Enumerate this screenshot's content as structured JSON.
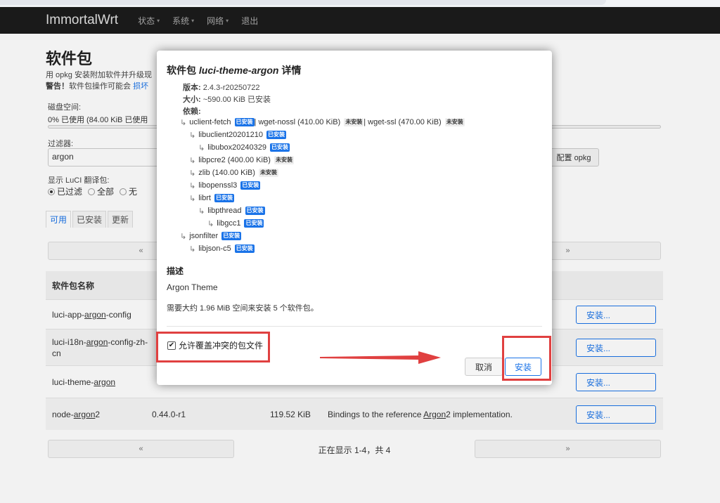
{
  "navbar": {
    "brand": "ImmortalWrt",
    "menu": [
      {
        "label": "状态",
        "has_caret": true
      },
      {
        "label": "系统",
        "has_caret": true
      },
      {
        "label": "网络",
        "has_caret": true
      },
      {
        "label": "退出",
        "has_caret": false
      }
    ]
  },
  "page": {
    "title": "软件包",
    "description": "用 opkg 安装附加软件并升级现",
    "warning_prefix": "警告！",
    "warning_text": "软件包操作可能会",
    "warning_link": "损坏",
    "disk_label": "磁盘空间:",
    "disk_value": "0% 已使用 (84.00 KiB 已使用",
    "filter_label": "过滤器:",
    "filter_value": "argon",
    "config_button": "配置 opkg",
    "luci_label": "显示 LuCI 翻译包:",
    "radio_options": [
      {
        "label": "已过滤",
        "checked": true
      },
      {
        "label": "全部",
        "checked": false
      },
      {
        "label": "无",
        "checked": false
      }
    ],
    "tabs": [
      {
        "label": "可用",
        "active": true
      },
      {
        "label": "已安装",
        "active": false
      },
      {
        "label": "更新",
        "active": false
      }
    ],
    "pager": {
      "prev": "«",
      "next": "»",
      "info": "正在显示 1-4，共 4"
    },
    "table": {
      "header": "软件包名称",
      "rows": [
        {
          "name_pre": "luci-app-",
          "name_hl": "argon",
          "name_post": "-config",
          "version": "",
          "size": "",
          "desc_pre": "",
          "desc_hl": "",
          "desc_post": "",
          "button": "安装..."
        },
        {
          "name_pre": "luci-i18n-",
          "name_hl": "argon",
          "name_post": "-config-zh-cn",
          "version": "",
          "size": "",
          "desc_pre": "",
          "desc_hl": "",
          "desc_post": "",
          "button": "安装..."
        },
        {
          "name_pre": "luci-theme-",
          "name_hl": "argon",
          "name_post": "",
          "version": "",
          "size": "",
          "desc_pre": "",
          "desc_hl": "",
          "desc_post": "",
          "button": "安装..."
        },
        {
          "name_pre": "node-",
          "name_hl": "argon",
          "name_post": "2",
          "version": "0.44.0-r1",
          "size": "119.52 KiB",
          "desc_pre": "Bindings to the reference ",
          "desc_hl": "Argon",
          "desc_post": "2 implementation.",
          "button": "安装..."
        }
      ]
    }
  },
  "modal": {
    "title_prefix": "软件包 ",
    "title_pkg": "luci-theme-argon",
    "title_suffix": " 详情",
    "version_label": "版本:",
    "version_value": "2.4.3-r20250722",
    "size_label": "大小:",
    "size_value": "~590.00 KiB 已安装",
    "deps_label": "依赖:",
    "dependencies": [
      {
        "indent": 0,
        "parts": [
          {
            "text": "uclient-fetch",
            "badge": "已安装",
            "status": "installed"
          },
          {
            "text": " | wget-nossl (410.00 KiB)",
            "badge": "未安装",
            "status": "not"
          },
          {
            "text": " | wget-ssl (470.00 KiB)",
            "badge": "未安装",
            "status": "not"
          }
        ]
      },
      {
        "indent": 1,
        "parts": [
          {
            "text": "libuclient20201210",
            "badge": "已安装",
            "status": "installed"
          }
        ]
      },
      {
        "indent": 2,
        "parts": [
          {
            "text": "libubox20240329",
            "badge": "已安装",
            "status": "installed"
          }
        ]
      },
      {
        "indent": 1,
        "parts": [
          {
            "text": "libpcre2 (400.00 KiB)",
            "badge": "未安装",
            "status": "not"
          }
        ]
      },
      {
        "indent": 1,
        "parts": [
          {
            "text": "zlib (140.00 KiB)",
            "badge": "未安装",
            "status": "not"
          }
        ]
      },
      {
        "indent": 1,
        "parts": [
          {
            "text": "libopenssl3",
            "badge": "已安装",
            "status": "installed"
          }
        ]
      },
      {
        "indent": 1,
        "parts": [
          {
            "text": "librt",
            "badge": "已安装",
            "status": "installed"
          }
        ]
      },
      {
        "indent": 2,
        "parts": [
          {
            "text": "libpthread",
            "badge": "已安装",
            "status": "installed"
          }
        ]
      },
      {
        "indent": 3,
        "parts": [
          {
            "text": "libgcc1",
            "badge": "已安装",
            "status": "installed"
          }
        ]
      },
      {
        "indent": 0,
        "parts": [
          {
            "text": "jsonfilter",
            "badge": "已安装",
            "status": "installed"
          }
        ]
      },
      {
        "indent": 1,
        "parts": [
          {
            "text": "libjson-c5",
            "badge": "已安装",
            "status": "installed"
          }
        ]
      }
    ],
    "desc_title": "描述",
    "desc_text": "Argon Theme",
    "space_text": "需要大约 1.96 MiB 空间来安装 5 个软件包。",
    "overwrite_label": "允许覆盖冲突的包文件",
    "overwrite_checked": true,
    "cancel_button": "取消",
    "install_button": "安装"
  },
  "colors": {
    "accent": "#1a73e8",
    "annotation": "#e04040",
    "navbar": "#1c1c1c"
  }
}
